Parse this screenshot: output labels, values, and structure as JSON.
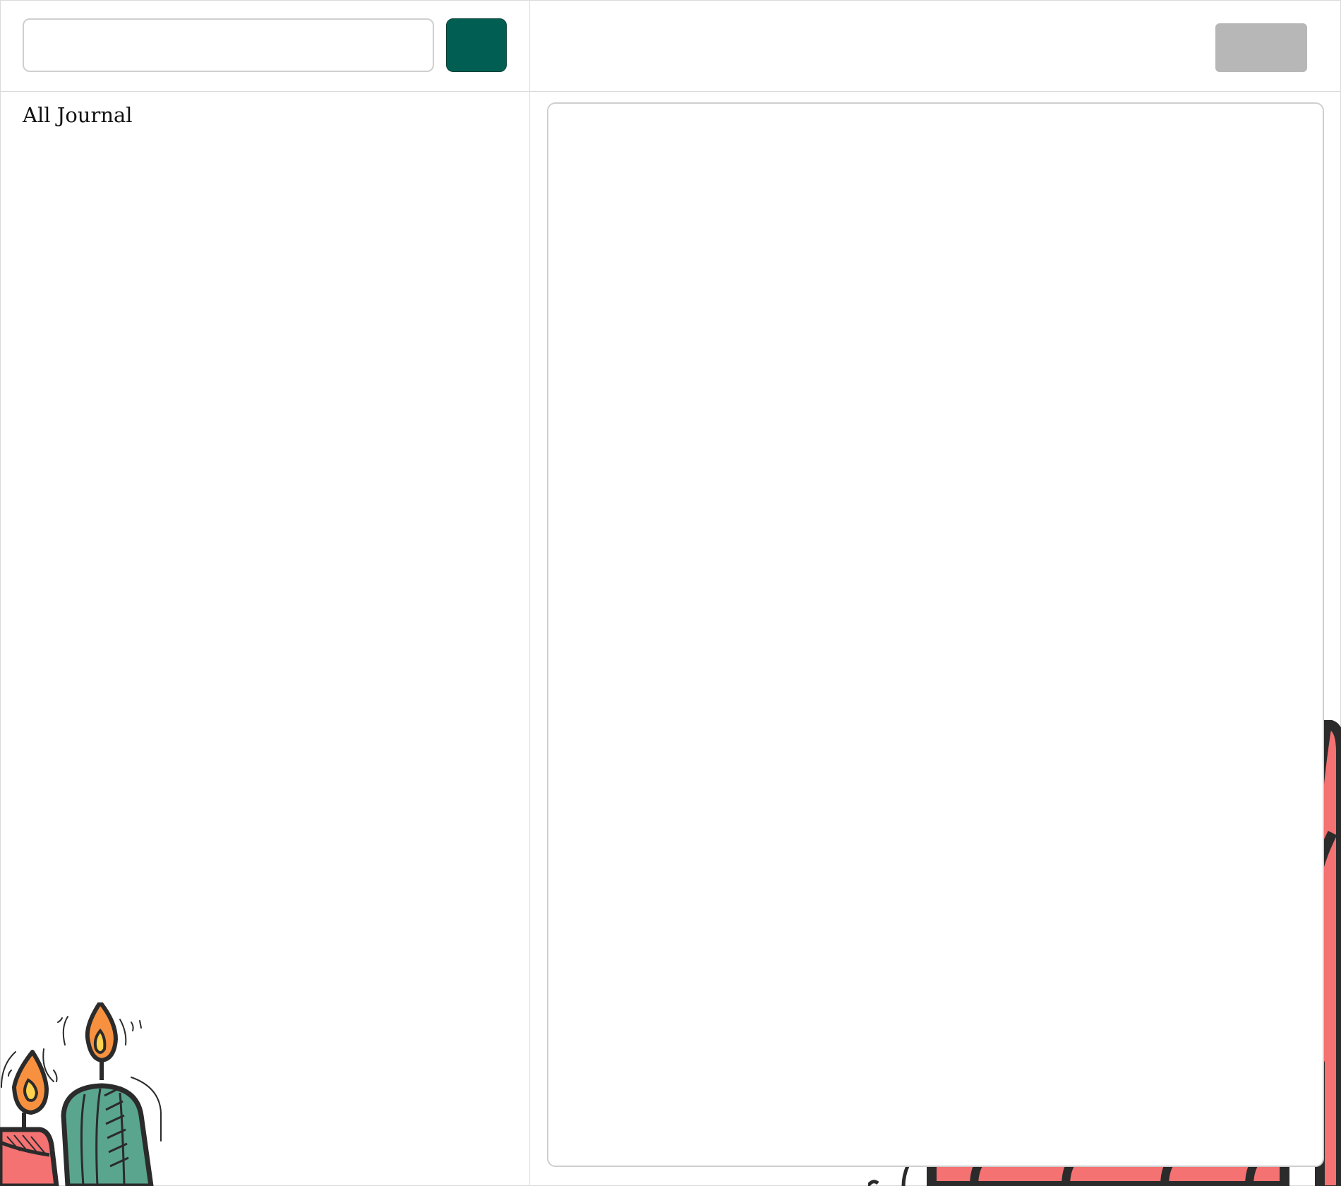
{
  "search": {
    "value": "",
    "placeholder": ""
  },
  "buttons": {
    "add_label": "",
    "save_label": ""
  },
  "sidebar": {
    "title": "All Journal",
    "entries": []
  },
  "editor": {
    "value": "",
    "placeholder": ""
  },
  "colors": {
    "accent": "#005f52",
    "disabled": "#b7b7b7",
    "decor_red": "#f47272",
    "decor_green": "#5aa58e",
    "flame": "#f7913f"
  },
  "icons": [
    "candles-illustration",
    "decorative-illustration"
  ]
}
